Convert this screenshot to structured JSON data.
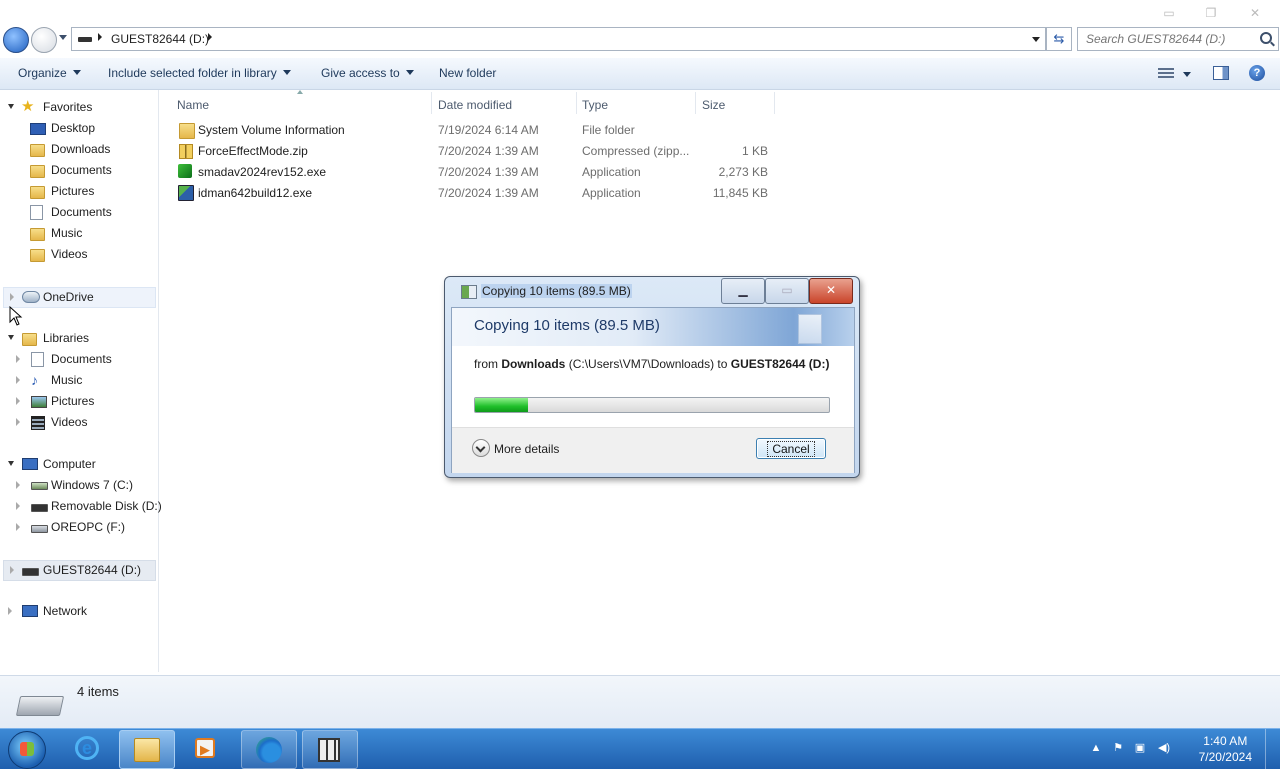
{
  "window": {
    "controls": [
      "▭",
      "❐",
      "✕"
    ]
  },
  "address": {
    "path": "GUEST82644 (D:)",
    "search_placeholder": "Search GUEST82644 (D:)"
  },
  "toolbar": {
    "organize": "Organize",
    "include_library": "Include selected folder in library",
    "give_access": "Give access to",
    "new_folder": "New folder",
    "help": "?"
  },
  "nav": {
    "favorites": "Favorites",
    "favorites_items": [
      "Desktop",
      "Downloads",
      "Documents",
      "Pictures",
      "Documents",
      "Music",
      "Videos"
    ],
    "onedrive": "OneDrive",
    "libraries": "Libraries",
    "libraries_items": [
      "Documents",
      "Music",
      "Pictures",
      "Videos"
    ],
    "computer": "Computer",
    "computer_items": [
      "Windows 7 (C:)",
      "Removable Disk (D:)",
      "OREOPC (F:)"
    ],
    "current_drive": "GUEST82644 (D:)",
    "network": "Network"
  },
  "file_list": {
    "columns": [
      "Name",
      "Date modified",
      "Type",
      "Size"
    ],
    "rows": [
      {
        "name": "System Volume Information",
        "date": "7/19/2024 6:14 AM",
        "type": "File folder",
        "size": ""
      },
      {
        "name": "ForceEffectMode.zip",
        "date": "7/20/2024 1:39 AM",
        "type": "Compressed (zipp...",
        "size": "1 KB"
      },
      {
        "name": "smadav2024rev152.exe",
        "date": "7/20/2024 1:39 AM",
        "type": "Application",
        "size": "2,273 KB"
      },
      {
        "name": "idman642build12.exe",
        "date": "7/20/2024 1:39 AM",
        "type": "Application",
        "size": "11,845 KB"
      }
    ]
  },
  "status": {
    "items": "4 items"
  },
  "copy_dialog": {
    "title": "Copying 10 items (89.5 MB)",
    "heading": "Copying 10 items (89.5 MB)",
    "from_prefix": "from ",
    "from_source": "Downloads",
    "from_path": " (C:\\Users\\VM7\\Downloads) to ",
    "to_target": "GUEST82644 (D:)",
    "progress_fraction": 0.15,
    "more_details": "More details",
    "cancel": "Cancel"
  },
  "taskbar": {
    "time": "1:40 AM",
    "date": "7/20/2024",
    "tray_up": "▲",
    "tray_flag": "⚑",
    "tray_net": "▣",
    "tray_vol": "◀)"
  }
}
